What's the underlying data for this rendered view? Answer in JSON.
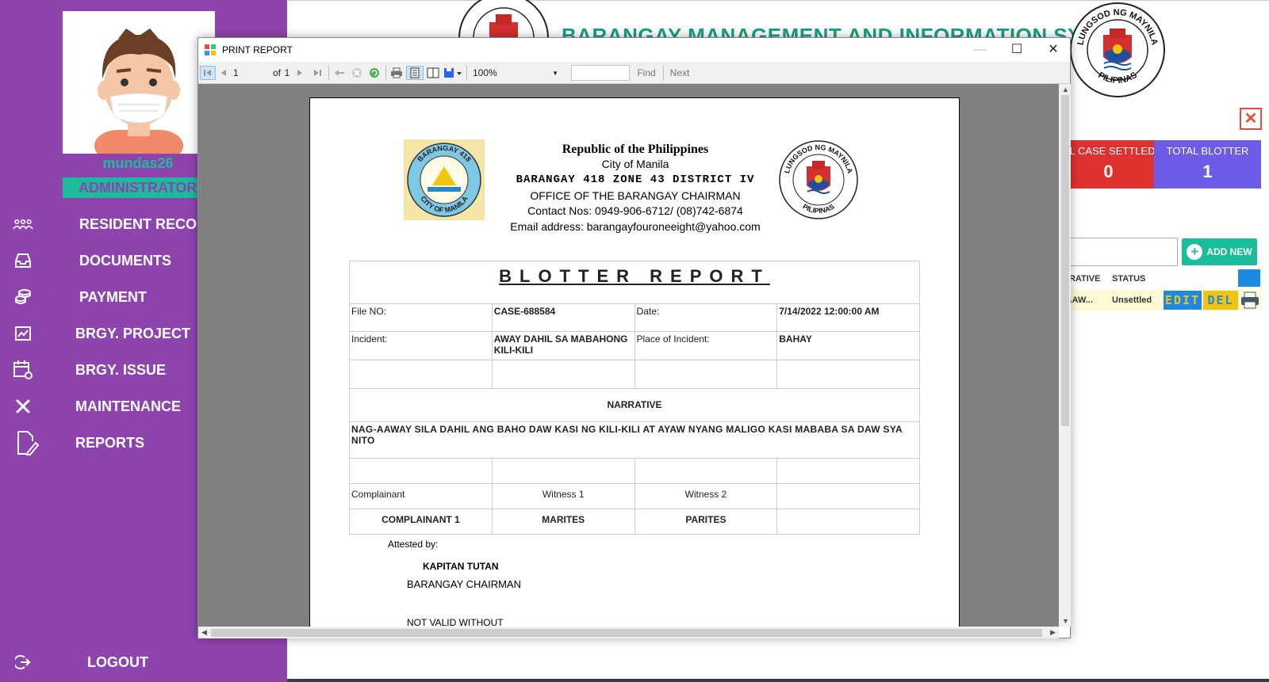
{
  "sidebar": {
    "username": "mundas26",
    "role": "ADMINISTRATOR",
    "items": [
      {
        "label": "RESIDENT RECOR",
        "icon": "residents-icon"
      },
      {
        "label": "DOCUMENTS",
        "icon": "inbox-icon"
      },
      {
        "label": "PAYMENT",
        "icon": "coins-icon"
      },
      {
        "label": "BRGY. PROJECT",
        "icon": "chart-icon"
      },
      {
        "label": "BRGY. ISSUE",
        "icon": "calendar-gear-icon"
      },
      {
        "label": "MAINTENANCE",
        "icon": "tools-icon"
      },
      {
        "label": "REPORTS",
        "icon": "document-edit-icon"
      }
    ],
    "logout": "LOGOUT"
  },
  "main": {
    "system_title": "BARANGAY MANAGEMENT AND INFORMATION SYSTEM",
    "seal_text_top": "LUNGSOD NG MAYNILA",
    "seal_text_bottom": "PILIPINAS",
    "cards": [
      {
        "title": "AL CASE SETTLED",
        "value": "0",
        "color": "#e03131"
      },
      {
        "title": "TOTAL BLOTTER",
        "value": "1",
        "color": "#6c5ce7"
      }
    ],
    "add_new_label": "ADD NEW",
    "grid_headers": [
      "RRATIVE",
      "STATUS"
    ],
    "grid_row": {
      "narrative": "-AAW...",
      "status": "Unsettled",
      "edit": "EDIT",
      "del": "DEL"
    }
  },
  "window": {
    "title": "PRINT REPORT",
    "toolbar": {
      "page": "1",
      "of_label": "of",
      "total_pages": "1",
      "zoom": "100%",
      "find_label": "Find",
      "next_label": "Next"
    }
  },
  "report": {
    "republic": "Republic of the Philippines",
    "city": "City of Manila",
    "barangay": "BARANGAY 418 ZONE 43 DISTRICT IV",
    "office": "OFFICE OF THE BARANGAY CHAIRMAN",
    "contact": "Contact Nos: 0949-906-6712/ (08)742-6874",
    "email": "Email address: barangayfouroneeight@yahoo.com",
    "logo_left_top": "BARANGAY 418",
    "logo_left_bottom": "CITY OF MANILA",
    "title": "BLOTTER REPORT",
    "file_no_label": "File NO:",
    "file_no": "CASE-688584",
    "date_label": "Date:",
    "date": "7/14/2022 12:00:00 AM",
    "incident_label": "Incident:",
    "incident": "AWAY DAHIL SA MABAHONG KILI-KILI",
    "place_label": "Place of Incident:",
    "place": "BAHAY",
    "narrative_title": "NARRATIVE",
    "narrative": "NAG-AAWAY SILA DAHIL ANG BAHO DAW KASI NG KILI-KILI AT AYAW NYANG MALIGO KASI MABABA SA DAW SYA NITO",
    "complainant_label": "Complainant",
    "witness1_label": "Witness 1",
    "witness2_label": "Witness 2",
    "complainant": "COMPLAINANT 1",
    "witness1": "MARITES",
    "witness2": "PARITES",
    "attested_by": "Attested by:",
    "kapitan": "KAPITAN TUTAN",
    "chairman": "BARANGAY CHAIRMAN",
    "not_valid": "NOT VALID WITHOUT"
  }
}
